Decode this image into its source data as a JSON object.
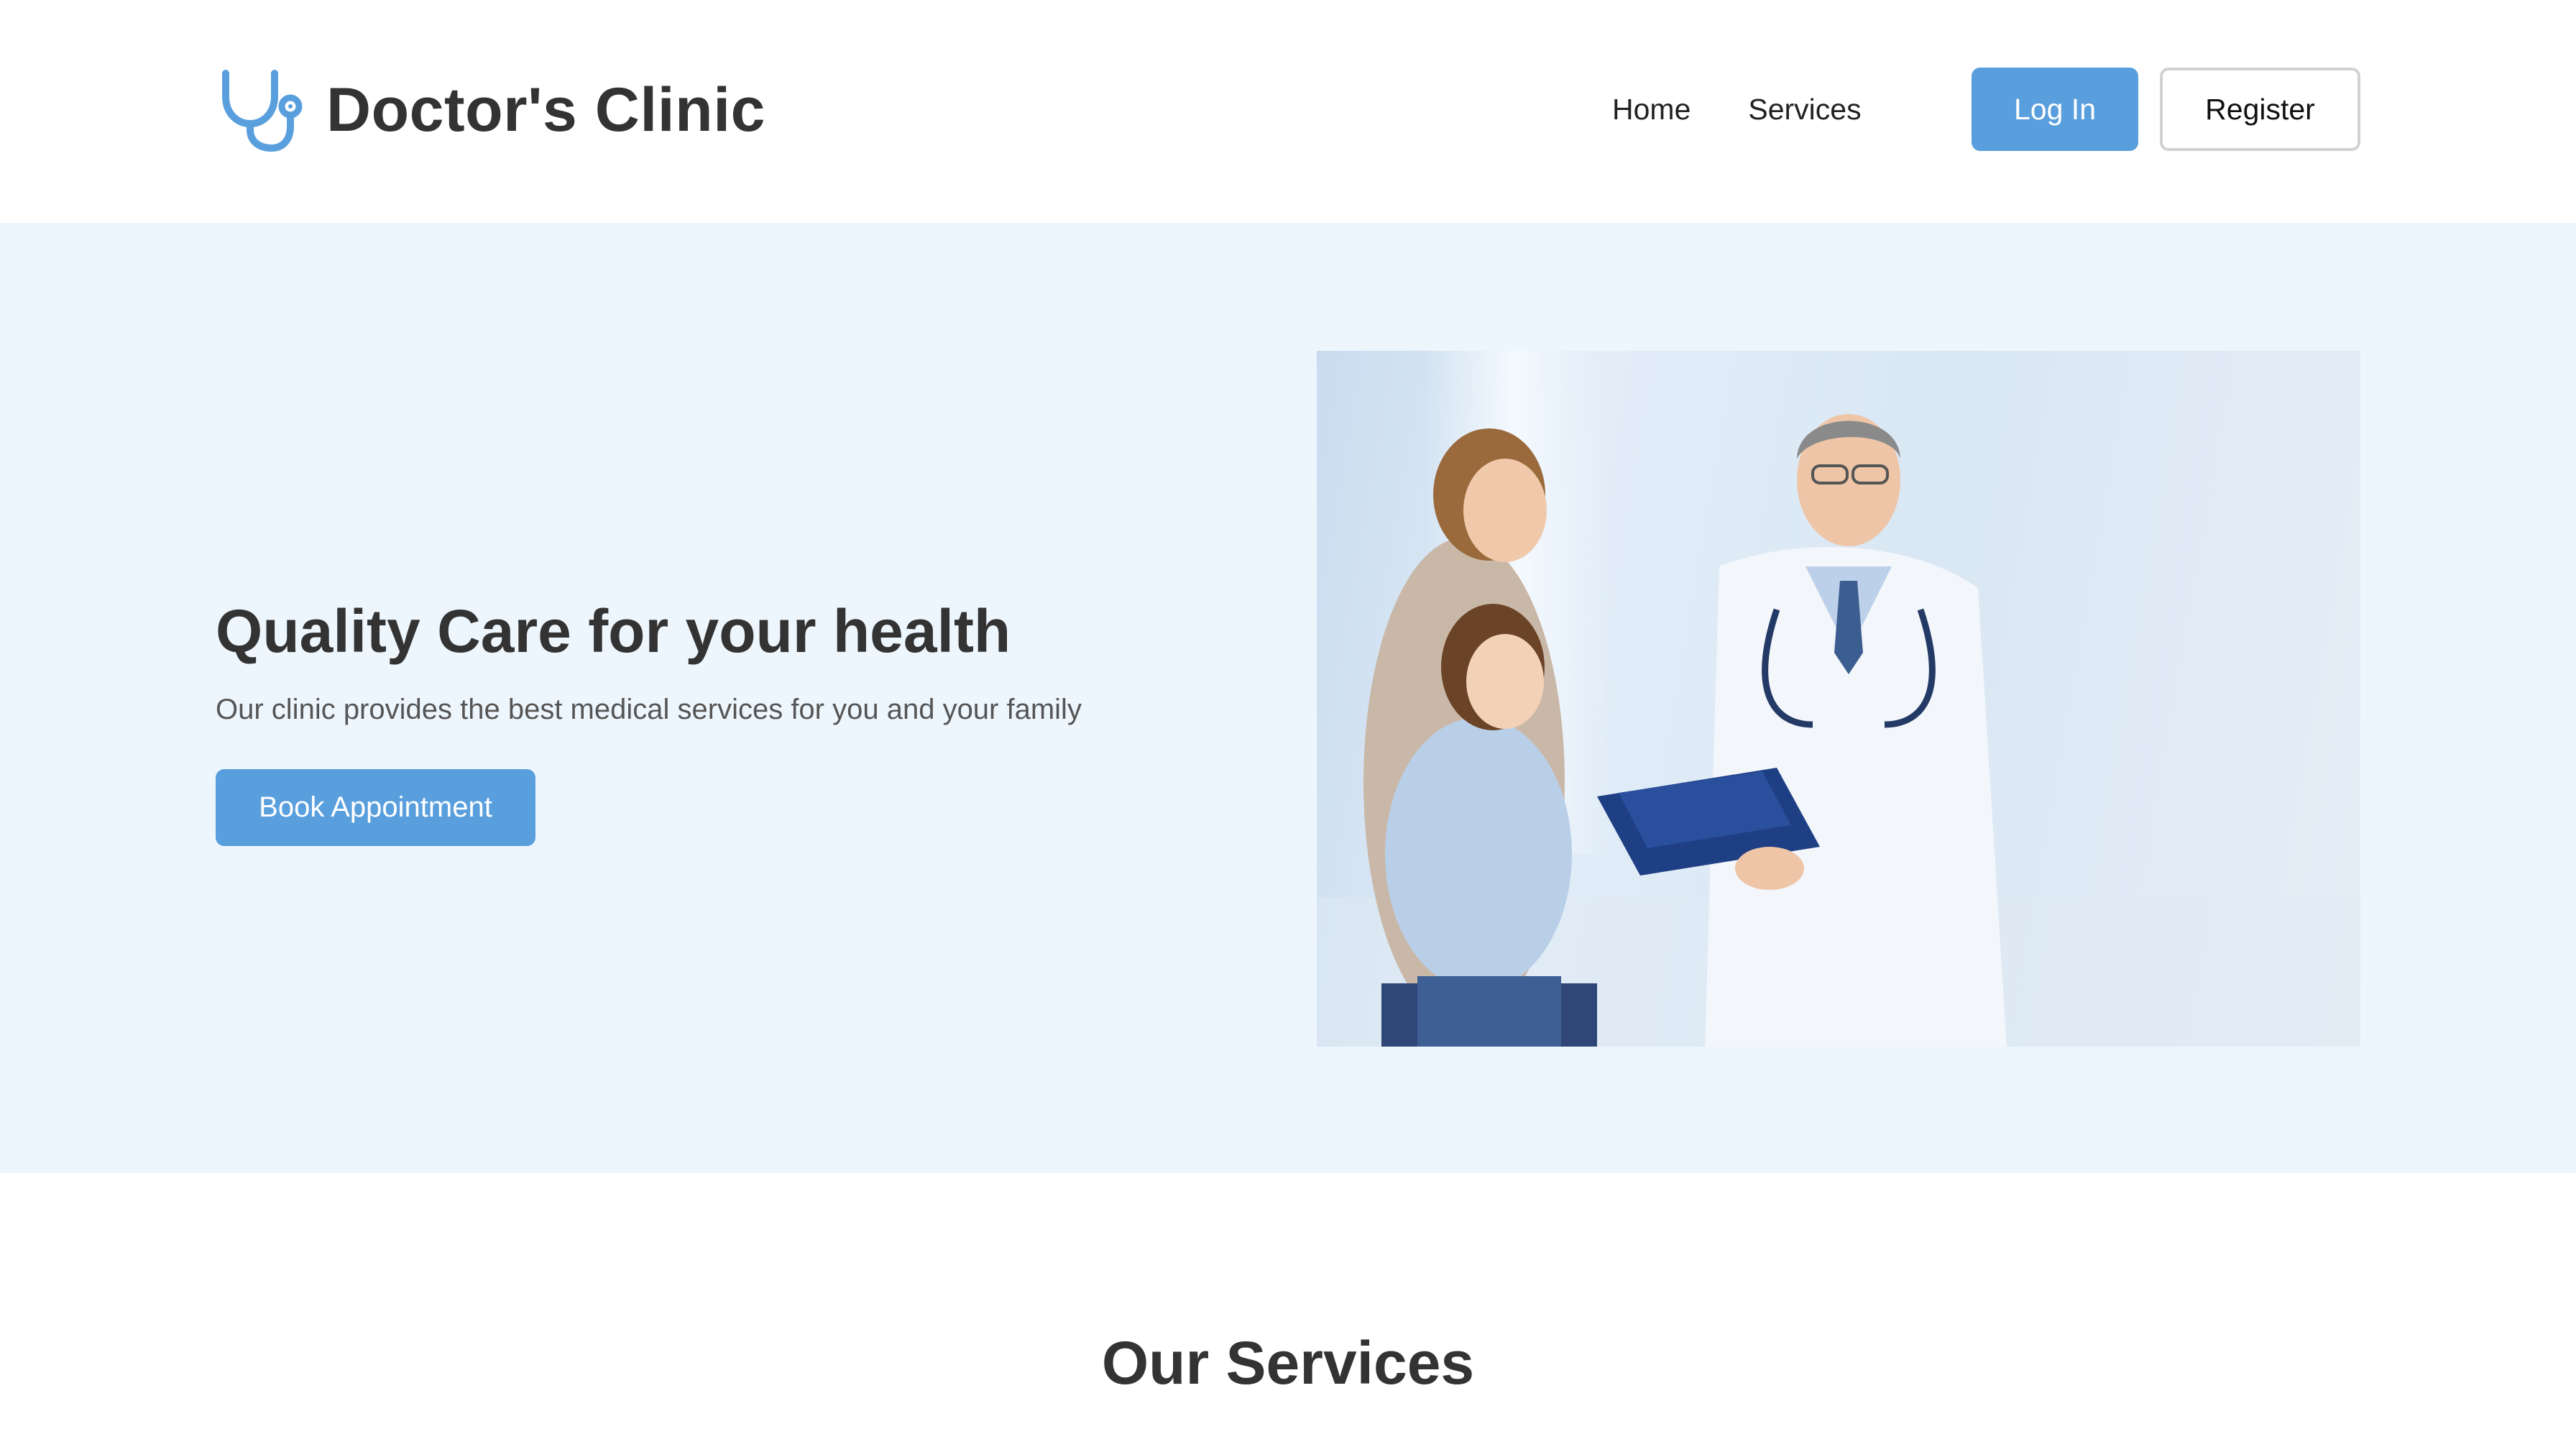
{
  "header": {
    "site_title": "Doctor's Clinic",
    "logo_icon": "stethoscope-icon",
    "nav": [
      {
        "label": "Home"
      },
      {
        "label": "Services"
      }
    ],
    "login_label": "Log In",
    "register_label": "Register"
  },
  "hero": {
    "title": "Quality Care for your health",
    "subtitle": "Our clinic provides the best medical services for you and your family",
    "cta_label": "Book Appointment",
    "image": "photo-doctor-with-mother-and-daughter"
  },
  "services": {
    "title": "Our Services"
  },
  "colors": {
    "accent": "#5a9fdd",
    "hero_background": "#eef6fd",
    "text_dark": "#333333",
    "text_muted": "#555555"
  }
}
